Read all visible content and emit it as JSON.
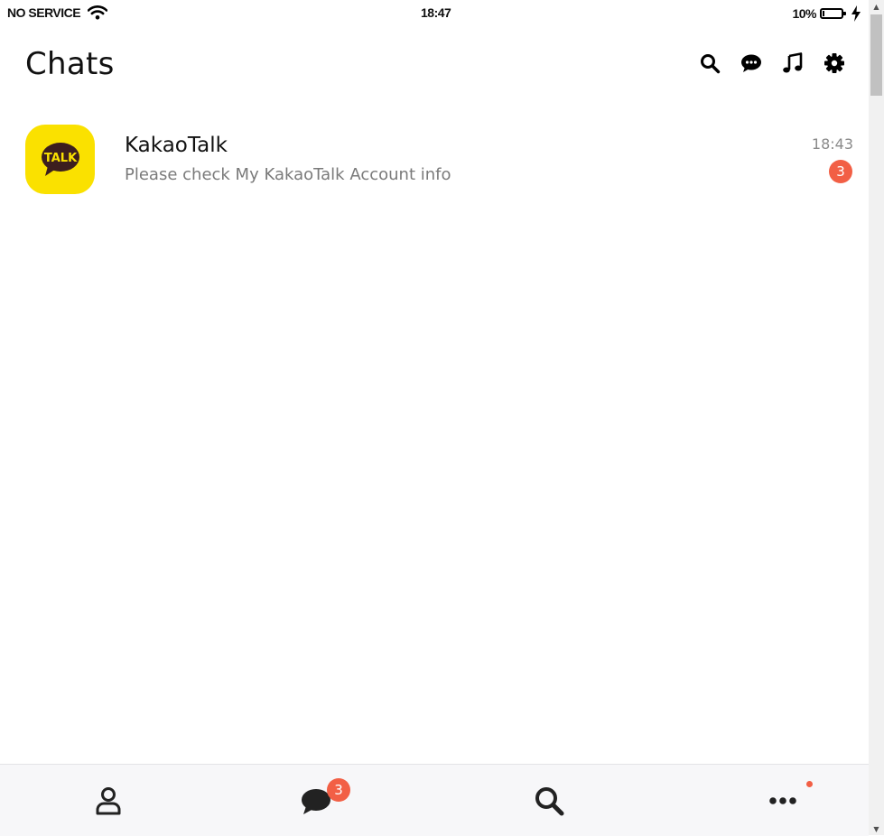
{
  "status_bar": {
    "carrier": "NO SERVICE",
    "time": "18:47",
    "battery_text": "10%",
    "battery_level": 0.1
  },
  "header": {
    "title": "Chats",
    "icons": [
      "search-icon",
      "new-chat-icon",
      "music-icon",
      "settings-icon"
    ]
  },
  "chats": [
    {
      "name": "KakaoTalk",
      "preview": "Please check My KakaoTalk Account info",
      "time": "18:43",
      "unread": "3",
      "avatar_text": "TALK",
      "avatar_color": "#fae100"
    }
  ],
  "bottom_nav": {
    "items": [
      "friends-icon",
      "chats-icon",
      "search-icon",
      "more-icon"
    ],
    "chats_badge": "3",
    "more_has_dot": true
  },
  "colors": {
    "badge": "#f25f45",
    "kakao_yellow": "#fae100",
    "kakao_brown": "#3c1e1e"
  }
}
